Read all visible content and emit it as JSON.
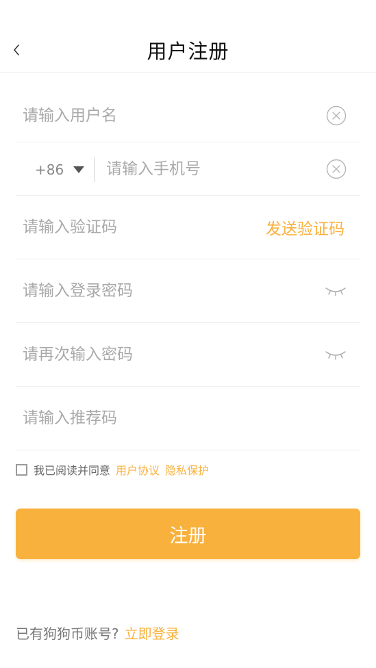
{
  "header": {
    "title": "用户注册"
  },
  "form": {
    "username": {
      "placeholder": "请输入用户名",
      "value": ""
    },
    "phone": {
      "country_code": "+86",
      "placeholder": "请输入手机号",
      "value": ""
    },
    "verify_code": {
      "placeholder": "请输入验证码",
      "value": "",
      "send_label": "发送验证码"
    },
    "password": {
      "placeholder": "请输入登录密码",
      "value": ""
    },
    "confirm_password": {
      "placeholder": "请再次输入密码",
      "value": ""
    },
    "referral": {
      "placeholder": "请输入推荐码",
      "value": ""
    }
  },
  "agreement": {
    "checked": false,
    "text": "我已阅读并同意",
    "user_agreement": "用户协议",
    "privacy": "隐私保护"
  },
  "register_button": "注册",
  "footer": {
    "prompt": "已有狗狗币账号?",
    "login_link": "立即登录"
  },
  "colors": {
    "accent": "#f9b13d",
    "placeholder": "#a9a9a9",
    "divider": "#eeeeee"
  },
  "icons": {
    "back": "chevron-left-icon",
    "clear": "clear-circle-icon",
    "dropdown": "triangle-down-icon",
    "password_hidden": "eye-closed-icon"
  }
}
